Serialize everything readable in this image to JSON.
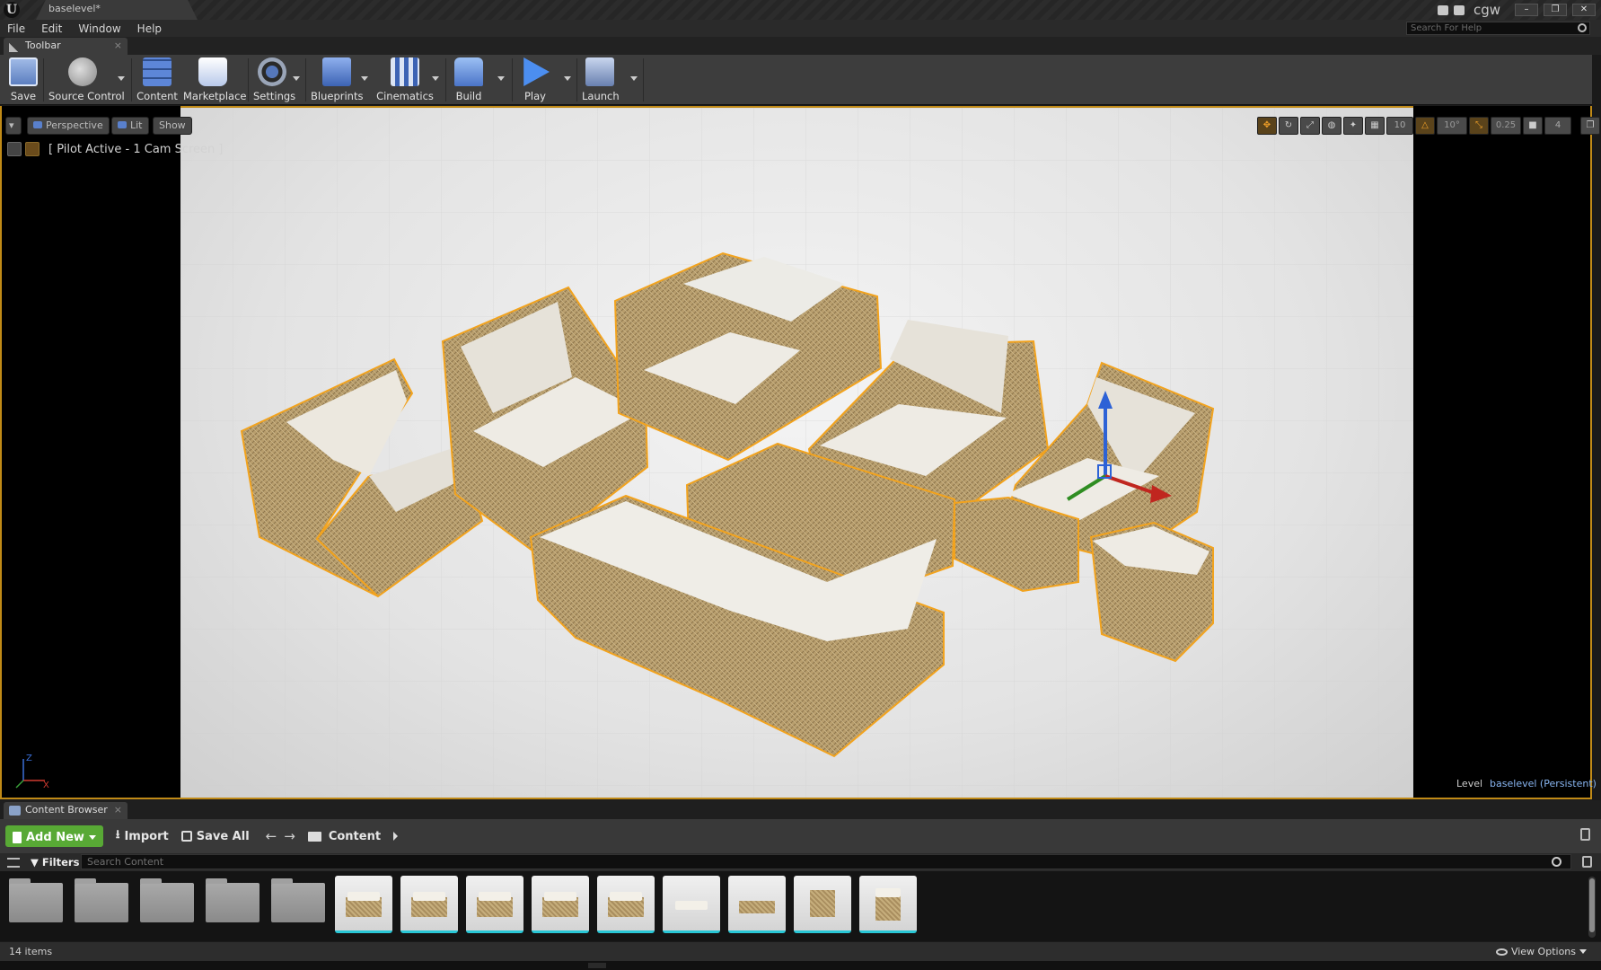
{
  "window": {
    "doc_tab": "baselevel*",
    "user": "cgw",
    "controls": [
      "–",
      "❐",
      "✕"
    ]
  },
  "menu": {
    "items": [
      "File",
      "Edit",
      "Window",
      "Help"
    ],
    "help_search_placeholder": "Search For Help"
  },
  "toolbar_tab": {
    "label": "Toolbar",
    "close": "×"
  },
  "toolbar": {
    "buttons": [
      {
        "label": "Save",
        "icon": "save-icon"
      },
      {
        "label": "Source Control",
        "icon": "source-control-icon"
      },
      {
        "label": "Content",
        "icon": "content-icon"
      },
      {
        "label": "Marketplace",
        "icon": "marketplace-icon"
      },
      {
        "label": "Settings",
        "icon": "settings-icon"
      },
      {
        "label": "Blueprints",
        "icon": "blueprints-icon"
      },
      {
        "label": "Cinematics",
        "icon": "cinematics-icon"
      },
      {
        "label": "Build",
        "icon": "build-icon"
      },
      {
        "label": "Play",
        "icon": "play-icon"
      },
      {
        "label": "Launch",
        "icon": "launch-icon"
      }
    ]
  },
  "viewport": {
    "menu_caret": "▾",
    "view_mode": "Perspective",
    "lit_mode": "Lit",
    "show": "Show",
    "pilot_label": "[ Pilot Active - 1 Cam Screen ]",
    "grid_snap": "10",
    "rotation_snap": "10°",
    "scale_snap": "0.25",
    "camera_speed": "4",
    "level_label": "Level",
    "level_name": "baselevel (Persistent)",
    "axis_labels": {
      "z": "Z",
      "x": "X"
    },
    "selection_color": "#f2a31e"
  },
  "content_browser": {
    "tab_label": "Content Browser",
    "tab_close": "×",
    "add_new": "Add New",
    "import": "Import",
    "save_all": "Save All",
    "nav_back": "←",
    "nav_forward": "→",
    "path": "Content",
    "filters": "Filters",
    "search_placeholder": "Search Content",
    "item_count": "14 items",
    "view_options": "View Options",
    "accent_color": "#29c7d6",
    "folders": 5,
    "meshes": 9
  }
}
